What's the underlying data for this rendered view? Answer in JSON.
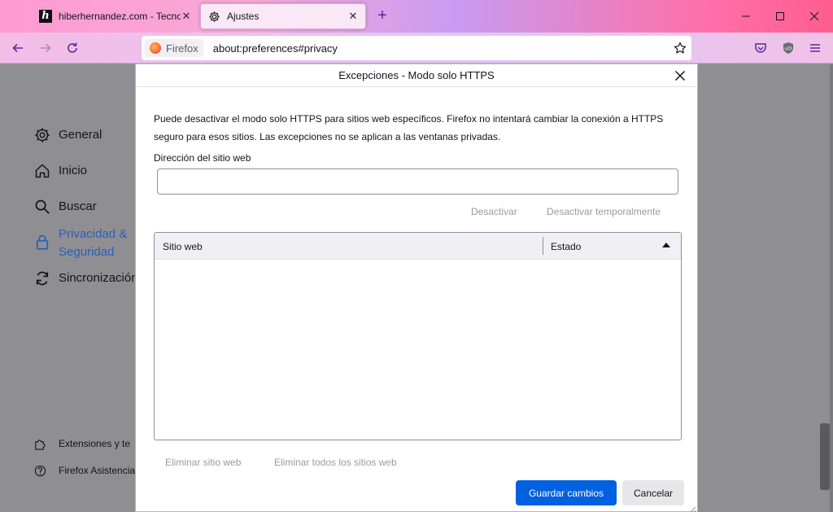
{
  "browser": {
    "tabs": [
      {
        "title": "hiberhernandez.com - Tecnolog",
        "icon": "h-logo-icon"
      },
      {
        "title": "Ajustes",
        "icon": "gear-icon"
      }
    ],
    "identity_label": "Firefox",
    "url": "about:preferences#privacy"
  },
  "sidebar": {
    "items": [
      {
        "label": "General",
        "icon": "gear-icon"
      },
      {
        "label": "Inicio",
        "icon": "home-icon"
      },
      {
        "label": "Buscar",
        "icon": "search-icon"
      },
      {
        "label_line1": "Privacidad &",
        "label_line2": "Seguridad",
        "icon": "lock-icon",
        "active": true
      },
      {
        "label": "Sincronización",
        "icon": "sync-icon"
      }
    ],
    "footer": [
      {
        "label": "Extensiones y te",
        "icon": "puzzle-icon"
      },
      {
        "label": "Firefox Asistencia",
        "icon": "help-icon"
      }
    ]
  },
  "dialog": {
    "title": "Excepciones - Modo solo HTTPS",
    "description_line1": "Puede desactivar el modo solo HTTPS para sitios web específicos. Firefox no intentará cambiar la conexión a HTTPS",
    "description_line2": "seguro para esos sitios. Las excepciones no se aplican a las ventanas privadas.",
    "address_label": "Dirección del sitio web",
    "address_value": "",
    "disable_label": "Desactivar",
    "disable_temp_label": "Desactivar temporalmente",
    "table": {
      "columns": [
        "Sitio web",
        "Estado"
      ],
      "rows": []
    },
    "remove_label": "Eliminar sitio web",
    "remove_all_label": "Eliminar todos los sitios web",
    "save_label": "Guardar cambios",
    "cancel_label": "Cancelar"
  },
  "colors": {
    "accent": "#0061e0",
    "active_nav": "#2b5fb8"
  }
}
